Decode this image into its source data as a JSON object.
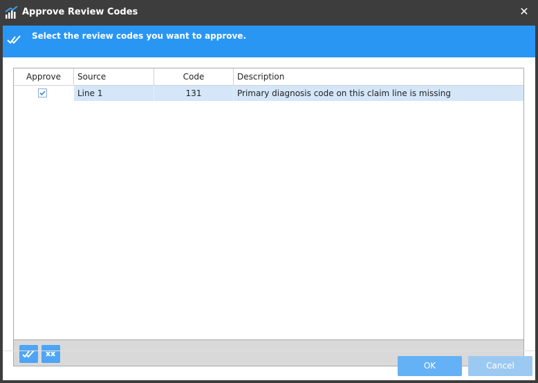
{
  "window": {
    "title": "Approve Review Codes",
    "close_glyph": "✕",
    "icon": "bar-chart-icon"
  },
  "banner": {
    "text": "Select the review codes you want to approve.",
    "icon": "double-check-icon",
    "color": "#2a96f4"
  },
  "grid": {
    "columns": [
      "Approve",
      "Source",
      "Code",
      "Description"
    ],
    "rows": [
      {
        "approve": true,
        "source": "Line 1",
        "code": "131",
        "description": "Primary diagnosis code on this claim line is missing"
      }
    ],
    "selected_row_color": "#d4e6f8"
  },
  "footer_tools": [
    {
      "icon": "select-all-icon"
    },
    {
      "icon": "deselect-all-icon"
    }
  ],
  "buttons": {
    "ok": "OK",
    "cancel": "Cancel"
  }
}
